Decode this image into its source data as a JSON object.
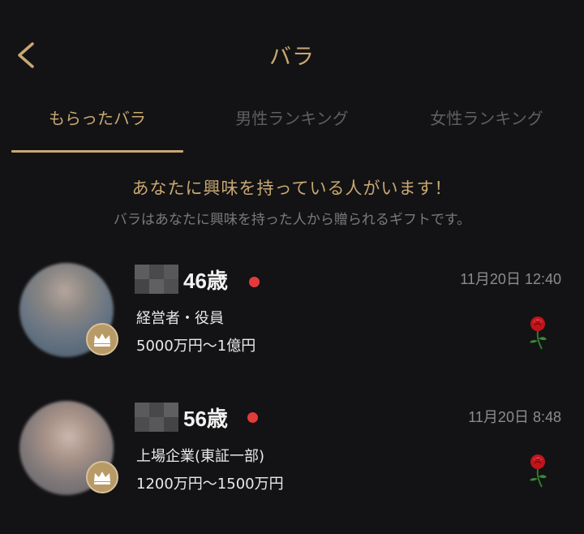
{
  "header": {
    "back_icon": "chevron-left-icon",
    "title": "バラ"
  },
  "tabs": [
    {
      "label": "もらったバラ",
      "active": true
    },
    {
      "label": "男性ランキング",
      "active": false
    },
    {
      "label": "女性ランキング",
      "active": false
    }
  ],
  "intro": {
    "headline": "あなたに興味を持っている人がいます！",
    "subtext": "バラはあなたに興味を持った人から贈られるギフトです。"
  },
  "roses": [
    {
      "age": "46歳",
      "online": true,
      "timestamp": "11月20日 12:40",
      "occupation": "経営者・役員",
      "income": "5000万円〜1億円",
      "badge_icon": "crown-icon",
      "gift_icon": "rose-icon"
    },
    {
      "age": "56歳",
      "online": true,
      "timestamp": "11月20日 8:48",
      "occupation": "上場企業(東証一部)",
      "income": "1200万円〜1500万円",
      "badge_icon": "crown-icon",
      "gift_icon": "rose-icon"
    }
  ],
  "colors": {
    "background": "#131315",
    "accent_gold": "#c9a872",
    "inactive_tab": "#5f5f63",
    "online_dot": "#e23b3b",
    "rose_red": "#c0141b"
  }
}
